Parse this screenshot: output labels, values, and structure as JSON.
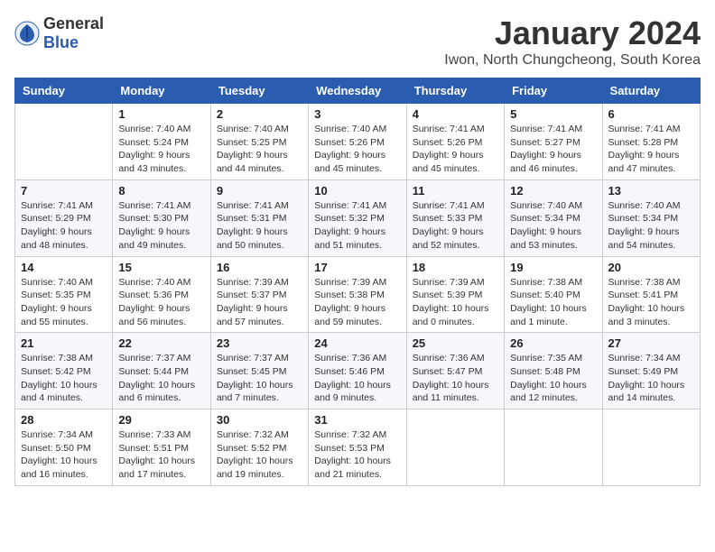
{
  "header": {
    "logo_general": "General",
    "logo_blue": "Blue",
    "month_title": "January 2024",
    "location": "Iwon, North Chungcheong, South Korea"
  },
  "weekdays": [
    "Sunday",
    "Monday",
    "Tuesday",
    "Wednesday",
    "Thursday",
    "Friday",
    "Saturday"
  ],
  "weeks": [
    [
      {
        "day": "",
        "info": ""
      },
      {
        "day": "1",
        "info": "Sunrise: 7:40 AM\nSunset: 5:24 PM\nDaylight: 9 hours\nand 43 minutes."
      },
      {
        "day": "2",
        "info": "Sunrise: 7:40 AM\nSunset: 5:25 PM\nDaylight: 9 hours\nand 44 minutes."
      },
      {
        "day": "3",
        "info": "Sunrise: 7:40 AM\nSunset: 5:26 PM\nDaylight: 9 hours\nand 45 minutes."
      },
      {
        "day": "4",
        "info": "Sunrise: 7:41 AM\nSunset: 5:26 PM\nDaylight: 9 hours\nand 45 minutes."
      },
      {
        "day": "5",
        "info": "Sunrise: 7:41 AM\nSunset: 5:27 PM\nDaylight: 9 hours\nand 46 minutes."
      },
      {
        "day": "6",
        "info": "Sunrise: 7:41 AM\nSunset: 5:28 PM\nDaylight: 9 hours\nand 47 minutes."
      }
    ],
    [
      {
        "day": "7",
        "info": "Sunrise: 7:41 AM\nSunset: 5:29 PM\nDaylight: 9 hours\nand 48 minutes."
      },
      {
        "day": "8",
        "info": "Sunrise: 7:41 AM\nSunset: 5:30 PM\nDaylight: 9 hours\nand 49 minutes."
      },
      {
        "day": "9",
        "info": "Sunrise: 7:41 AM\nSunset: 5:31 PM\nDaylight: 9 hours\nand 50 minutes."
      },
      {
        "day": "10",
        "info": "Sunrise: 7:41 AM\nSunset: 5:32 PM\nDaylight: 9 hours\nand 51 minutes."
      },
      {
        "day": "11",
        "info": "Sunrise: 7:41 AM\nSunset: 5:33 PM\nDaylight: 9 hours\nand 52 minutes."
      },
      {
        "day": "12",
        "info": "Sunrise: 7:40 AM\nSunset: 5:34 PM\nDaylight: 9 hours\nand 53 minutes."
      },
      {
        "day": "13",
        "info": "Sunrise: 7:40 AM\nSunset: 5:34 PM\nDaylight: 9 hours\nand 54 minutes."
      }
    ],
    [
      {
        "day": "14",
        "info": "Sunrise: 7:40 AM\nSunset: 5:35 PM\nDaylight: 9 hours\nand 55 minutes."
      },
      {
        "day": "15",
        "info": "Sunrise: 7:40 AM\nSunset: 5:36 PM\nDaylight: 9 hours\nand 56 minutes."
      },
      {
        "day": "16",
        "info": "Sunrise: 7:39 AM\nSunset: 5:37 PM\nDaylight: 9 hours\nand 57 minutes."
      },
      {
        "day": "17",
        "info": "Sunrise: 7:39 AM\nSunset: 5:38 PM\nDaylight: 9 hours\nand 59 minutes."
      },
      {
        "day": "18",
        "info": "Sunrise: 7:39 AM\nSunset: 5:39 PM\nDaylight: 10 hours\nand 0 minutes."
      },
      {
        "day": "19",
        "info": "Sunrise: 7:38 AM\nSunset: 5:40 PM\nDaylight: 10 hours\nand 1 minute."
      },
      {
        "day": "20",
        "info": "Sunrise: 7:38 AM\nSunset: 5:41 PM\nDaylight: 10 hours\nand 3 minutes."
      }
    ],
    [
      {
        "day": "21",
        "info": "Sunrise: 7:38 AM\nSunset: 5:42 PM\nDaylight: 10 hours\nand 4 minutes."
      },
      {
        "day": "22",
        "info": "Sunrise: 7:37 AM\nSunset: 5:44 PM\nDaylight: 10 hours\nand 6 minutes."
      },
      {
        "day": "23",
        "info": "Sunrise: 7:37 AM\nSunset: 5:45 PM\nDaylight: 10 hours\nand 7 minutes."
      },
      {
        "day": "24",
        "info": "Sunrise: 7:36 AM\nSunset: 5:46 PM\nDaylight: 10 hours\nand 9 minutes."
      },
      {
        "day": "25",
        "info": "Sunrise: 7:36 AM\nSunset: 5:47 PM\nDaylight: 10 hours\nand 11 minutes."
      },
      {
        "day": "26",
        "info": "Sunrise: 7:35 AM\nSunset: 5:48 PM\nDaylight: 10 hours\nand 12 minutes."
      },
      {
        "day": "27",
        "info": "Sunrise: 7:34 AM\nSunset: 5:49 PM\nDaylight: 10 hours\nand 14 minutes."
      }
    ],
    [
      {
        "day": "28",
        "info": "Sunrise: 7:34 AM\nSunset: 5:50 PM\nDaylight: 10 hours\nand 16 minutes."
      },
      {
        "day": "29",
        "info": "Sunrise: 7:33 AM\nSunset: 5:51 PM\nDaylight: 10 hours\nand 17 minutes."
      },
      {
        "day": "30",
        "info": "Sunrise: 7:32 AM\nSunset: 5:52 PM\nDaylight: 10 hours\nand 19 minutes."
      },
      {
        "day": "31",
        "info": "Sunrise: 7:32 AM\nSunset: 5:53 PM\nDaylight: 10 hours\nand 21 minutes."
      },
      {
        "day": "",
        "info": ""
      },
      {
        "day": "",
        "info": ""
      },
      {
        "day": "",
        "info": ""
      }
    ]
  ]
}
